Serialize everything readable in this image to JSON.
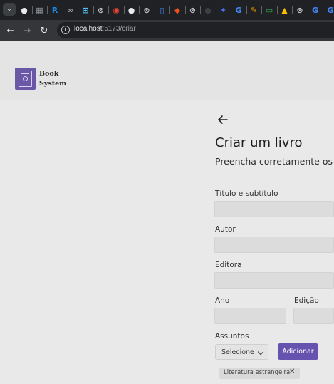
{
  "browser": {
    "url_host": "localhost",
    "url_path": ":5173/criar",
    "tab_favicons": [
      {
        "name": "github-icon",
        "color": "#e8eaed",
        "glyph": "●"
      },
      {
        "name": "grid-icon",
        "color": "#9aa0a6",
        "glyph": "▦"
      },
      {
        "name": "r-icon",
        "color": "#1e88e5",
        "glyph": "R"
      },
      {
        "name": "loop-icon",
        "color": "#9aa0a6",
        "glyph": "∞"
      },
      {
        "name": "brackets-icon",
        "color": "#4fc3f7",
        "glyph": "⊞"
      },
      {
        "name": "network-icon",
        "color": "#bdc1c6",
        "glyph": "⊗"
      },
      {
        "name": "chrome-icon",
        "color": "#ea4335",
        "glyph": "◉"
      },
      {
        "name": "github-icon",
        "color": "#e8eaed",
        "glyph": "●"
      },
      {
        "name": "network-icon",
        "color": "#bdc1c6",
        "glyph": "⊗"
      },
      {
        "name": "doc-icon",
        "color": "#4285f4",
        "glyph": "▯"
      },
      {
        "name": "figma-icon",
        "color": "#f24e1e",
        "glyph": "◆"
      },
      {
        "name": "network-icon",
        "color": "#bdc1c6",
        "glyph": "⊗"
      },
      {
        "name": "dark-circle-icon",
        "color": "#3c4043",
        "glyph": "●"
      },
      {
        "name": "puzzle-icon",
        "color": "#4c6ef5",
        "glyph": "✦"
      },
      {
        "name": "google-icon",
        "color": "#4285f4",
        "glyph": "G"
      },
      {
        "name": "pencil-icon",
        "color": "#f29900",
        "glyph": "✎"
      },
      {
        "name": "chat-icon",
        "color": "#34a853",
        "glyph": "▭"
      },
      {
        "name": "drive-icon",
        "color": "#fbbc04",
        "glyph": "▲"
      },
      {
        "name": "network-icon",
        "color": "#bdc1c6",
        "glyph": "⊗"
      },
      {
        "name": "google-icon",
        "color": "#4285f4",
        "glyph": "G"
      },
      {
        "name": "google-icon",
        "color": "#4285f4",
        "glyph": "G"
      }
    ]
  },
  "header": {
    "logo_line1": "Book",
    "logo_line2": "System"
  },
  "form": {
    "title": "Criar um livro",
    "subtitle": "Preencha corretamente os ca",
    "fields": {
      "titulo_label": "Título e subtítulo",
      "autor_label": "Autor",
      "editora_label": "Editora",
      "ano_label": "Ano",
      "edicao_label": "Edição",
      "assuntos_label": "Assuntos"
    },
    "select_value": "Selecione",
    "add_button": "Adicionar",
    "chips": [
      "Literatura estrangeira"
    ],
    "chip_remove": "✕"
  },
  "colors": {
    "accent": "#6653b0",
    "logo": "#6a58a6"
  }
}
